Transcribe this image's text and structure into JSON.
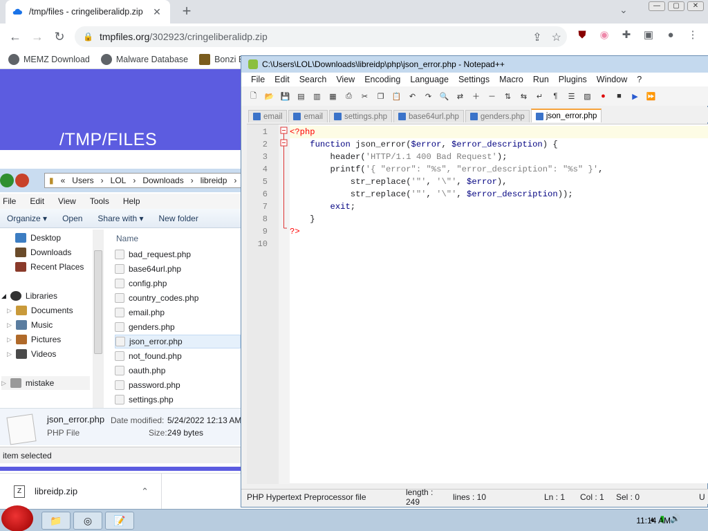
{
  "chrome": {
    "tab_title": "/tmp/files - cringeliberalidp.zip",
    "url_host": "tmpfiles.org",
    "url_path": "/302923/cringeliberalidp.zip",
    "bookmarks": [
      "MEMZ Download",
      "Malware Database",
      "Bonzi B"
    ]
  },
  "page": {
    "title": "/TMP/FILES"
  },
  "downloads": {
    "file": "libreidp.zip"
  },
  "explorer": {
    "path": [
      "Users",
      "LOL",
      "Downloads",
      "libreidp"
    ],
    "menu": [
      "File",
      "Edit",
      "View",
      "Tools",
      "Help"
    ],
    "commands": [
      "Organize",
      "Open",
      "Share with",
      "New folder"
    ],
    "nav": [
      "Desktop",
      "Downloads",
      "Recent Places",
      "Libraries",
      "Documents",
      "Music",
      "Pictures",
      "Videos",
      "mistake"
    ],
    "column_header": "Name",
    "files": [
      "bad_request.php",
      "base64url.php",
      "config.php",
      "country_codes.php",
      "email.php",
      "genders.php",
      "json_error.php",
      "not_found.php",
      "oauth.php",
      "password.php",
      "settings.php"
    ],
    "selected_file": "json_error.php",
    "details": {
      "name": "json_error.php",
      "type": "PHP File",
      "modified_label": "Date modified:",
      "modified": "5/24/2022 12:13 AM",
      "size_label": "Size:",
      "size": "249 bytes"
    },
    "status": "item selected"
  },
  "notepad": {
    "title": "C:\\Users\\LOL\\Downloads\\libreidp\\php\\json_error.php - Notepad++",
    "menu": [
      "File",
      "Edit",
      "Search",
      "View",
      "Encoding",
      "Language",
      "Settings",
      "Macro",
      "Run",
      "Plugins",
      "Window",
      "?"
    ],
    "tabs": [
      "email",
      "email",
      "settings.php",
      "base64url.php",
      "genders.php",
      "json_error.php"
    ],
    "active_tab": 5,
    "code_lines": [
      "<?php",
      "    function json_error($error, $error_description) {",
      "        header('HTTP/1.1 400 Bad Request');",
      "        printf('{ \"error\": \"%s\", \"error_description\": \"%s\" }',",
      "            str_replace('\"', '\\\"', $error),",
      "            str_replace('\"', '\\\"', $error_description));",
      "        exit;",
      "    }",
      "?>",
      ""
    ],
    "status": {
      "filetype": "PHP Hypertext Preprocessor file",
      "length": "length : 249",
      "lines": "lines : 10",
      "ln": "Ln : 1",
      "col": "Col : 1",
      "sel": "Sel : 0",
      "enc": "U"
    }
  },
  "taskbar": {
    "time": "11:14 AM"
  }
}
